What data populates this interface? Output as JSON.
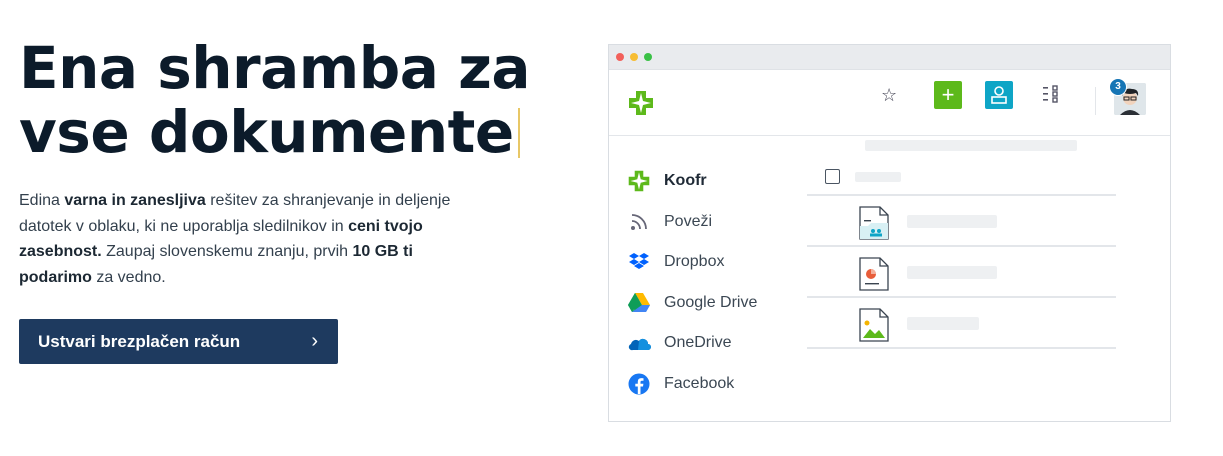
{
  "hero": {
    "headline_line1": "Ena shramba za",
    "headline_line2": "vse dokumente",
    "desc": {
      "p1": "Edina ",
      "b1": "varna in zanesljiva",
      "p2": " rešitev za shranjevanje in deljenje datotek v oblaku, ki ne uporablja sledilnikov in ",
      "b2": "ceni tvojo zasebnost.",
      "p3": " Zaupaj slovenskemu znanju, prvih ",
      "b3": "10 GB ti podarimo",
      "p4": " za vedno."
    },
    "cta_label": "Ustvari brezplačen račun",
    "cta_icon": "chevron-right-icon"
  },
  "app": {
    "notification_count": "3",
    "icons": [
      "koofr-logo",
      "star-icon",
      "plus-icon",
      "user-icon",
      "grid-list-icon",
      "avatar"
    ],
    "sidebar": [
      {
        "label": "Koofr",
        "icon": "koofr-icon",
        "active": true
      },
      {
        "label": "Poveži",
        "icon": "rss-icon",
        "active": false
      },
      {
        "label": "Dropbox",
        "icon": "dropbox-icon",
        "active": false
      },
      {
        "label": "Google Drive",
        "icon": "google-drive-icon",
        "active": false
      },
      {
        "label": "OneDrive",
        "icon": "onedrive-icon",
        "active": false
      },
      {
        "label": "Facebook",
        "icon": "facebook-icon",
        "active": false
      }
    ],
    "files": [
      "spreadsheet-file-icon",
      "presentation-file-icon",
      "image-file-icon"
    ]
  },
  "colors": {
    "headline": "#0c1b2a",
    "cta_bg": "#1e3a5f",
    "green": "#5db91b",
    "teal": "#0ea5c6",
    "badge": "#1675b5"
  }
}
